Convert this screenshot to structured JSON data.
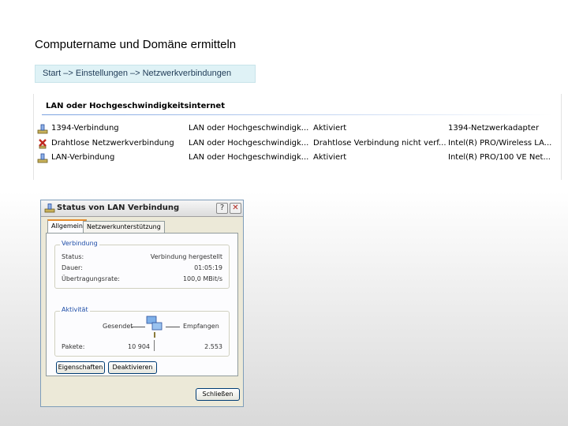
{
  "slide": {
    "title": "Computername und Domäne ermitteln",
    "path": "Start –> Einstellungen –> Netzwerkverbindungen"
  },
  "network_list": {
    "group_header": "LAN oder Hochgeschwindigkeitsinternet",
    "rows": [
      {
        "icon": "network-connection-icon",
        "name": "1394-Verbindung",
        "type": "LAN oder Hochgeschwindigk...",
        "status": "Aktiviert",
        "device": "1394-Netzwerkadapter"
      },
      {
        "icon": "wireless-disabled-icon",
        "name": "Drahtlose Netzwerkverbindung",
        "type": "LAN oder Hochgeschwindigk...",
        "status": "Drahtlose Verbindung nicht verf...",
        "device": "Intel(R) PRO/Wireless LA..."
      },
      {
        "icon": "network-connection-icon",
        "name": "LAN-Verbindung",
        "type": "LAN oder Hochgeschwindigk...",
        "status": "Aktiviert",
        "device": "Intel(R) PRO/100 VE Net..."
      }
    ]
  },
  "dialog": {
    "title": "Status von LAN Verbindung",
    "help_button": "?",
    "close_button": "✕",
    "tabs": [
      {
        "label": "Allgemein",
        "active": true
      },
      {
        "label": "Netzwerkunterstützung",
        "active": false
      }
    ],
    "connection_group": {
      "legend": "Verbindung",
      "rows": [
        {
          "label": "Status:",
          "value": "Verbindung hergestellt"
        },
        {
          "label": "Dauer:",
          "value": "01:05:19"
        },
        {
          "label": "Übertragungsrate:",
          "value": "100,0 MBit/s"
        }
      ]
    },
    "activity_group": {
      "legend": "Aktivität",
      "sent_label": "Gesendet",
      "received_label": "Empfangen",
      "packets_label": "Pakete:",
      "packets_sent": "10 904",
      "packets_received": "2.553"
    },
    "buttons": {
      "properties": "Eigenschaften",
      "disable": "Deaktivieren",
      "close": "Schließen"
    }
  },
  "colors": {
    "path_box_bg": "#dff2f6",
    "group_line": "#7ba2e0",
    "dialog_bg": "#ece9d8",
    "active_tab_accent": "#e68b2c"
  }
}
